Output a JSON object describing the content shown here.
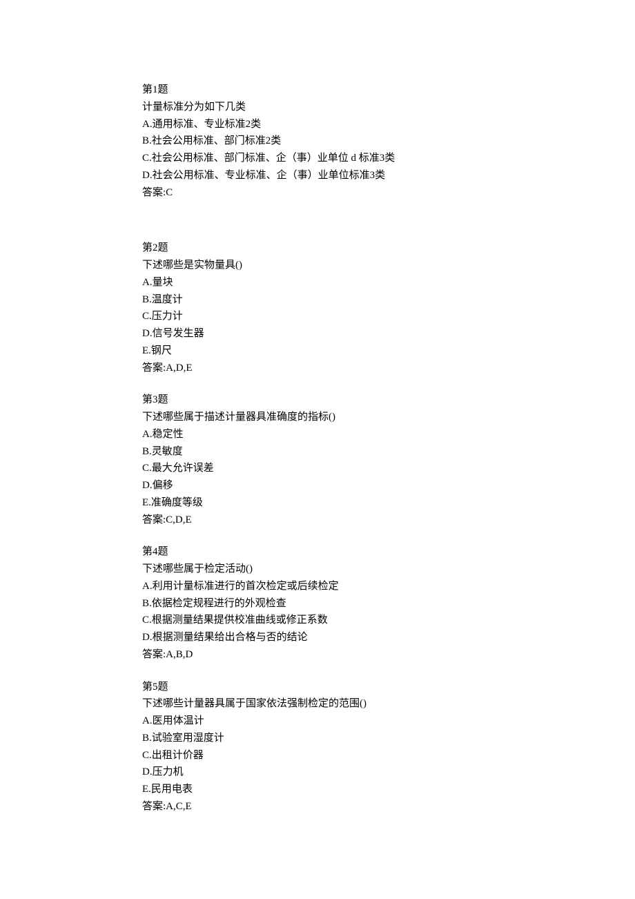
{
  "questions": [
    {
      "header": "第1题",
      "prompt": "计量标准分为如下几类",
      "options": [
        "A.通用标准、专业标准2类",
        "B.社会公用标准、部门标准2类",
        "C.社会公用标准、部门标准、企（事）业单位 d 标准3类",
        "D.社会公用标准、专业标准、企（事）业单位标准3类"
      ],
      "answer": "答案:C",
      "extra_gap": true
    },
    {
      "header": "第2题",
      "prompt": "下述哪些是实物量具()",
      "options": [
        "A.量块",
        "B.温度计",
        "C.压力计",
        "D.信号发生器",
        "E.钢尺"
      ],
      "answer": "答案:A,D,E",
      "extra_gap": false
    },
    {
      "header": "第3题",
      "prompt": "下述哪些属于描述计量器具准确度的指标()",
      "options": [
        "A.稳定性",
        "B.灵敏度",
        "C.最大允许误差",
        "D.偏移",
        "E.准确度等级"
      ],
      "answer": "答案:C,D,E",
      "extra_gap": false
    },
    {
      "header": "第4题",
      "prompt": "下述哪些属于检定活动()",
      "options": [
        "A.利用计量标准进行的首次检定或后续检定",
        "B.依据检定规程进行的外观检查",
        "C.根据测量结果提供校准曲线或修正系数",
        "D.根据测量结果给出合格与否的结论"
      ],
      "answer": "答案:A,B,D",
      "extra_gap": false
    },
    {
      "header": "第5题",
      "prompt": "下述哪些计量器具属于国家依法强制检定的范围()",
      "options": [
        "A.医用体温计",
        "B.试验室用湿度计",
        "C.出租计价器",
        "D.压力机",
        "E.民用电表"
      ],
      "answer": "答案:A,C,E",
      "extra_gap": false
    }
  ]
}
